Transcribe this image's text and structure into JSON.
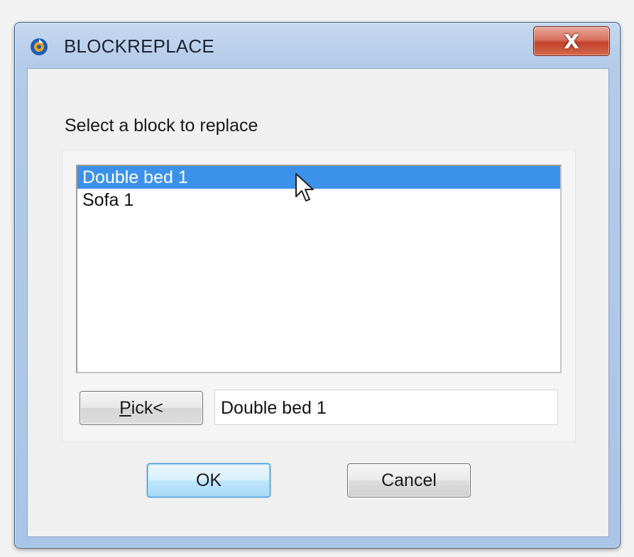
{
  "window": {
    "title": "BLOCKREPLACE",
    "close_label": "X",
    "icon": "app-logo-icon"
  },
  "dialog": {
    "prompt": "Select a block to replace",
    "blocks": [
      {
        "label": "Double bed 1",
        "selected": true
      },
      {
        "label": "Sofa 1",
        "selected": false
      }
    ],
    "pick_button": {
      "accel": "P",
      "rest": "ick<"
    },
    "selected_block_value": "Double bed 1",
    "ok_label": "OK",
    "cancel_label": "Cancel"
  },
  "colors": {
    "selection": "#3c92ea",
    "title_bar": "#b3cbe8",
    "close_button": "#c2432b",
    "default_button_border": "#3b8fd0"
  },
  "cursor": "arrow-pointer-icon"
}
